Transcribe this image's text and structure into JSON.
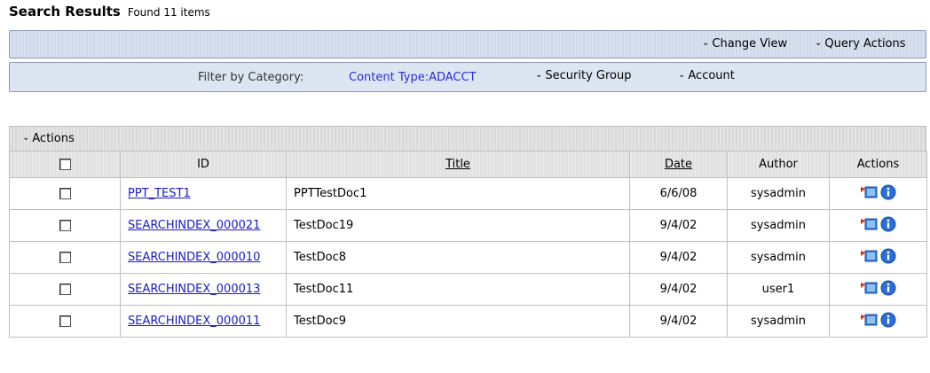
{
  "header": {
    "title": "Search Results",
    "count_text": "Found 11 items"
  },
  "toolbar": {
    "change_view": "Change View",
    "query_actions": "Query Actions"
  },
  "filter": {
    "label": "Filter by Category:",
    "content_type": "Content Type:ADACCT",
    "security_group": "Security Group",
    "account": "Account"
  },
  "actions_menu": {
    "label": "Actions"
  },
  "table": {
    "headers": {
      "id": "ID",
      "title": "Title",
      "date": "Date",
      "author": "Author",
      "actions": "Actions"
    },
    "rows": [
      {
        "id": "PPT_TEST1",
        "title": "PPTTestDoc1",
        "date": "6/6/08",
        "author": "sysadmin"
      },
      {
        "id": "SEARCHINDEX_000021",
        "title": "TestDoc19",
        "date": "9/4/02",
        "author": "sysadmin"
      },
      {
        "id": "SEARCHINDEX_000010",
        "title": "TestDoc8",
        "date": "9/4/02",
        "author": "sysadmin"
      },
      {
        "id": "SEARCHINDEX_000013",
        "title": "TestDoc11",
        "date": "9/4/02",
        "author": "user1"
      },
      {
        "id": "SEARCHINDEX_000011",
        "title": "TestDoc9",
        "date": "9/4/02",
        "author": "sysadmin"
      }
    ]
  },
  "colors": {
    "link": "#1a1acc",
    "filter_link": "#2a2ad6",
    "bar_bg": "#d8e1ef",
    "border": "#bfbfbf"
  },
  "icons": {
    "chevron": "chevron-down-icon",
    "row_action_doc": "document-action-icon",
    "row_action_info": "info-icon"
  }
}
